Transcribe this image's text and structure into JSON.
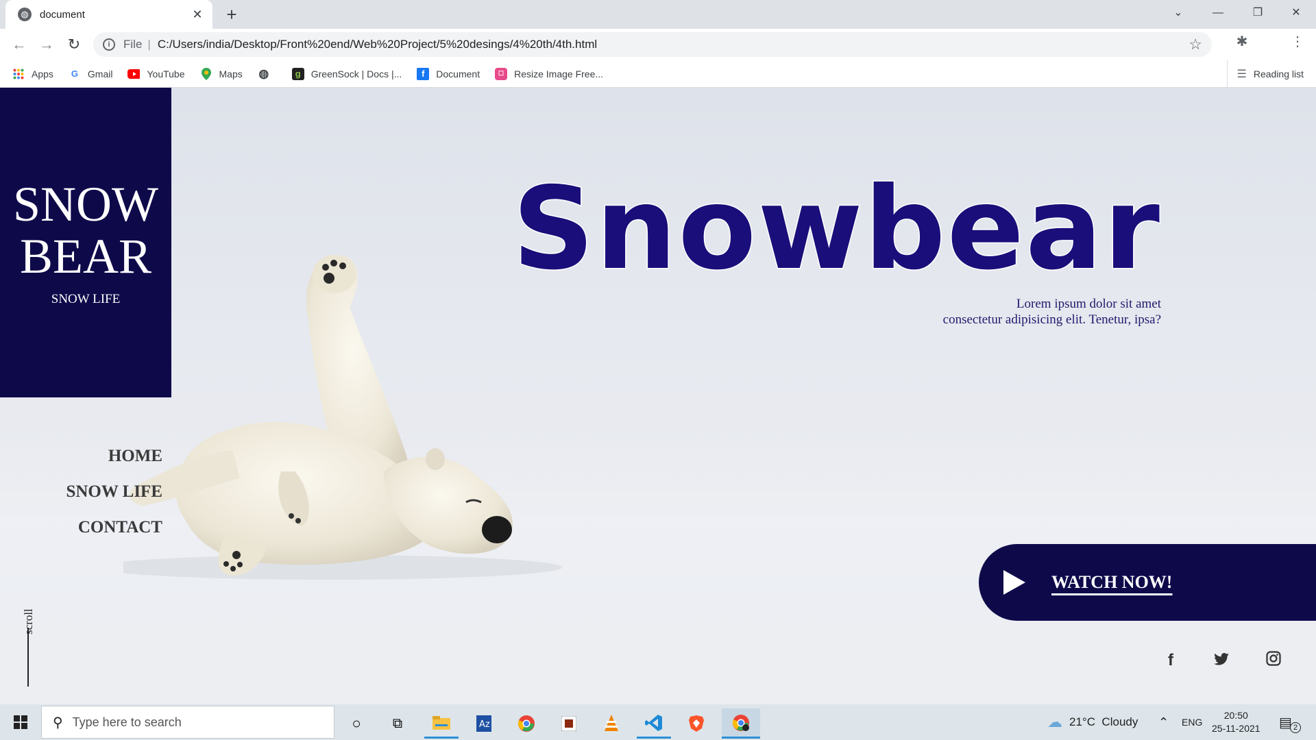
{
  "browser": {
    "tab_title": "document",
    "url_scheme": "File",
    "url": "C:/Users/india/Desktop/Front%20end/Web%20Project/5%20desings/4%20th/4th.html",
    "bookmarks": [
      {
        "label": "Apps",
        "icon": "apps-grid-icon"
      },
      {
        "label": "Gmail",
        "icon": "google-icon"
      },
      {
        "label": "YouTube",
        "icon": "youtube-icon"
      },
      {
        "label": "Maps",
        "icon": "maps-icon"
      },
      {
        "label": "",
        "icon": "globe-icon"
      },
      {
        "label": "GreenSock | Docs |...",
        "icon": "greensock-icon"
      },
      {
        "label": "Document",
        "icon": "facebook-icon"
      },
      {
        "label": "Resize Image Free...",
        "icon": "resize-image-icon"
      }
    ],
    "reading_list": "Reading list"
  },
  "page": {
    "logo": {
      "line1": "SNOW",
      "line2": "BEAR",
      "tagline": "SNOW LIFE"
    },
    "hero_title": "Snowbear",
    "hero_desc_line1": "Lorem ipsum dolor sit amet",
    "hero_desc_line2": "consectetur adipisicing elit. Tenetur, ipsa?",
    "nav": [
      "HOME",
      "SNOW LIFE",
      "CONTACT"
    ],
    "scroll_label": "scroll",
    "cta_label": "WATCH NOW!",
    "social": [
      "facebook-icon",
      "twitter-icon",
      "instagram-icon"
    ],
    "colors": {
      "brand": "#0e0a4a",
      "title": "#1a0e7a"
    }
  },
  "taskbar": {
    "search_placeholder": "Type here to search",
    "weather": "21°C  Cloudy",
    "lang": "ENG",
    "time": "20:50",
    "date": "25-11-2021",
    "notifications": "2"
  }
}
